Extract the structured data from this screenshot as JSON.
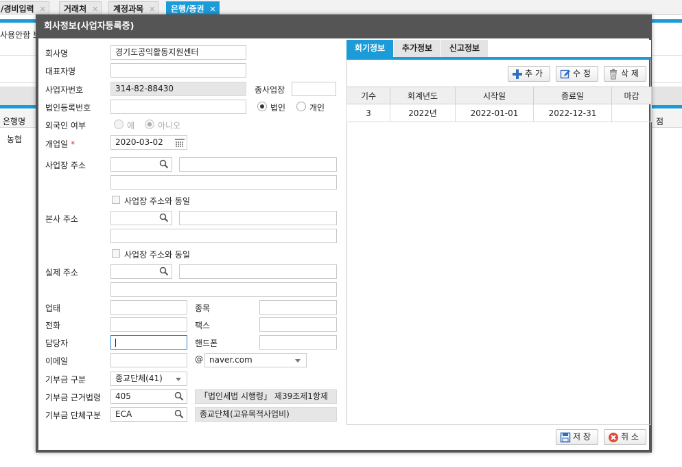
{
  "tabs": [
    {
      "label": "/경비입력"
    },
    {
      "label": "거래처"
    },
    {
      "label": "계정과목"
    },
    {
      "label": "은행/증권"
    }
  ],
  "background": {
    "partial_label": "사용안함 보",
    "col_bank": "은행명",
    "row_bank": "농협",
    "col_right": "점"
  },
  "dialog": {
    "title": "회사정보(사업자등록증)",
    "fields": {
      "company_name_label": "회사명",
      "company_name": "경기도공익활동지원센터",
      "ceo_label": "대표자명",
      "ceo": "",
      "bizno_label": "사업자번호",
      "bizno": "314-82-88430",
      "branch_label": "종사업장",
      "branch": "",
      "corpno_label": "법인등록번호",
      "corpno": "",
      "corp_option": "법인",
      "indiv_option": "개인",
      "foreigner_label": "외국인 여부",
      "yes_option": "예",
      "no_option": "아니오",
      "open_date_label": "개업일",
      "required_mark": "*",
      "open_date": "2020-03-02",
      "biz_addr_label": "사업장 주소",
      "same_as_biz_label": "사업장 주소와 동일",
      "hq_addr_label": "본사 주소",
      "real_addr_label": "실제 주소",
      "biztype_label": "업태",
      "bizitem_label": "종목",
      "phone_label": "전화",
      "fax_label": "팩스",
      "manager_label": "담당자",
      "mobile_label": "핸드폰",
      "email_label": "이메일",
      "at_sign": "@",
      "email_domain": "naver.com",
      "donation_type_label": "기부금 구분",
      "donation_type": "종교단체(41)",
      "donation_law_label": "기부금 근거법령",
      "donation_law_code": "405",
      "donation_law_desc": "「법인세법 시행령」 제39조제1항제",
      "donation_group_label": "기부금 단체구분",
      "donation_group_code": "ECA",
      "donation_group_desc": "종교단체(고유목적사업비)"
    },
    "right_tabs": [
      {
        "label": "회기정보"
      },
      {
        "label": "추가정보"
      },
      {
        "label": "신고정보"
      }
    ],
    "grid_buttons": {
      "add": "추 가",
      "edit": "수 정",
      "delete": "삭 제"
    },
    "grid": {
      "columns": [
        "기수",
        "회계년도",
        "시작일",
        "종료일",
        "마감"
      ],
      "rows": [
        [
          "3",
          "2022년",
          "2022-01-01",
          "2022-12-31",
          ""
        ]
      ]
    },
    "footer": {
      "save": "저 장",
      "cancel": "취 소"
    },
    "colors": {
      "accent": "#1b9bd8",
      "title_bar": "#555555"
    }
  }
}
